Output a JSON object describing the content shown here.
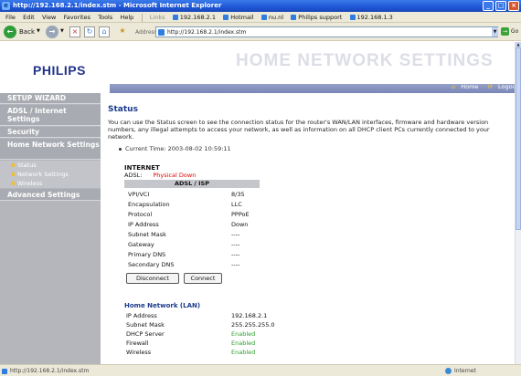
{
  "window": {
    "title": "http://192.168.2.1/index.stm - Microsoft Internet Explorer",
    "controls": {
      "minimize": "_",
      "maximize": "□",
      "close": "×"
    }
  },
  "menu": {
    "items": [
      "File",
      "Edit",
      "View",
      "Favorites",
      "Tools",
      "Help"
    ],
    "links_label": "Links",
    "links": [
      "192.168.2.1",
      "Hotmail",
      "nu.nl",
      "Philips support",
      "192.168.1.3"
    ]
  },
  "toolbar": {
    "back_label": "Back",
    "address_label": "Address",
    "address_value": "http://192.168.2.1/index.stm",
    "go_label": "Go"
  },
  "header": {
    "logo": "PHILIPS",
    "banner": "HOME NETWORK SETTINGS",
    "home_link": "Home",
    "logout_link": "Logout"
  },
  "sidebar": {
    "setup_wizard": "SETUP WIZARD",
    "adsl": "ADSL / Internet Settings",
    "security": "Security",
    "home_network": "Home Network Settings",
    "sub_status": "Status",
    "sub_network": "Network Settings",
    "sub_wireless": "Wireless",
    "advanced": "Advanced Settings"
  },
  "main": {
    "title": "Status",
    "intro": "You can use the Status screen to see the connection status for the router's WAN/LAN interfaces, firmware and hardware version numbers, any illegal attempts to access your network, as well as information on all DHCP client PCs currently connected to your network.",
    "current_time": "Current Time: 2003-08-02 10:59:11",
    "internet_heading": "INTERNET",
    "adsl_label": "ADSL:",
    "adsl_status": "Physical Down",
    "isp_heading": "ADSL / ISP",
    "isp_rows": [
      {
        "k": "VPI/VCI",
        "v": "8/35"
      },
      {
        "k": "Encapsulation",
        "v": "LLC"
      },
      {
        "k": "Protocol",
        "v": "PPPoE"
      },
      {
        "k": "IP Address",
        "v": "Down"
      },
      {
        "k": "Subnet Mask",
        "v": "----"
      },
      {
        "k": "Gateway",
        "v": "----"
      },
      {
        "k": "Primary DNS",
        "v": "----"
      },
      {
        "k": "Secondary DNS",
        "v": "----"
      }
    ],
    "disconnect_label": "Disconnect",
    "connect_label": "Connect",
    "lan_heading": "Home Network (LAN)",
    "lan_rows": [
      {
        "k": "IP Address",
        "v": "192.168.2.1"
      },
      {
        "k": "Subnet Mask",
        "v": "255.255.255.0"
      },
      {
        "k": "DHCP Server",
        "v": "Enabled"
      },
      {
        "k": "Firewall",
        "v": "Enabled"
      },
      {
        "k": "Wireless",
        "v": "Enabled"
      }
    ]
  },
  "statusbar": {
    "left": "http://192.168.2.1/index.stm",
    "zone": "Internet"
  },
  "colors": {
    "accent": "#1b3a8c",
    "error": "#dd0000",
    "ok": "#2e9e2e"
  }
}
